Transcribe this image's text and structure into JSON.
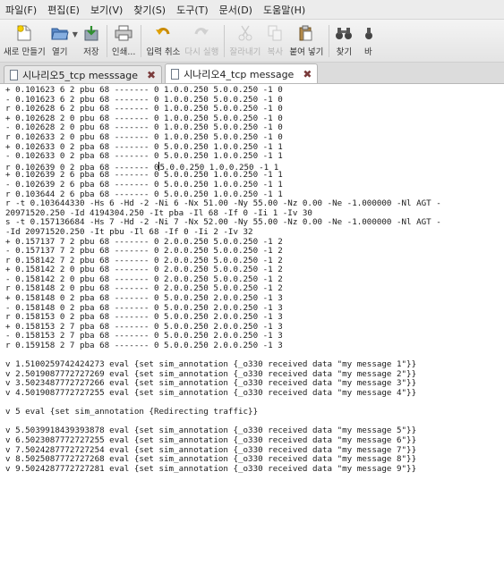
{
  "menu": [
    "파일(F)",
    "편집(E)",
    "보기(V)",
    "찾기(S)",
    "도구(T)",
    "문서(D)",
    "도움말(H)"
  ],
  "toolbar": {
    "new": "새로 만들기",
    "open": "열기",
    "save": "저장",
    "print": "인쇄...",
    "undo": "입력 취소",
    "redo": "다시 실행",
    "cut": "잘라내기",
    "copy": "복사",
    "paste": "붙여 넣기",
    "find": "찾기",
    "replace": "바"
  },
  "tabs": [
    {
      "label": "시나리오5_tcp messsage"
    },
    {
      "label": "시나리오4_tcp message"
    }
  ],
  "log": {
    "block1": [
      "+ 0.101623 6 2 pbu 68 ------- 0 1.0.0.250 5.0.0.250 -1 0",
      "- 0.101623 6 2 pbu 68 ------- 0 1.0.0.250 5.0.0.250 -1 0",
      "r 0.102628 6 2 pbu 68 ------- 0 1.0.0.250 5.0.0.250 -1 0",
      "+ 0.102628 2 0 pbu 68 ------- 0 1.0.0.250 5.0.0.250 -1 0",
      "- 0.102628 2 0 pbu 68 ------- 0 1.0.0.250 5.0.0.250 -1 0",
      "r 0.102633 2 0 pbu 68 ------- 0 1.0.0.250 5.0.0.250 -1 0",
      "+ 0.102633 0 2 pba 68 ------- 0 5.0.0.250 1.0.0.250 -1 1",
      "- 0.102633 0 2 pba 68 ------- 0 5.0.0.250 1.0.0.250 -1 1",
      "r 0.102639 0 2 pba 68 ------- 0",
      "5.0.0.250 1.0.0.250 -1 1",
      "+ 0.102639 2 6 pba 68 ------- 0 5.0.0.250 1.0.0.250 -1 1",
      "- 0.102639 2 6 pba 68 ------- 0 5.0.0.250 1.0.0.250 -1 1",
      "r 0.103644 2 6 pba 68 ------- 0 5.0.0.250 1.0.0.250 -1 1",
      "r -t 0.103644330 -Hs 6 -Hd -2 -Ni 6 -Nx 51.00 -Ny 55.00 -Nz 0.00 -Ne -1.000000 -Nl AGT -",
      "20971520.250 -Id 4194304.250 -It pba -Il 68 -If 0 -Ii 1 -Iv 30",
      "s -t 0.157136684 -Hs 7 -Hd -2 -Ni 7 -Nx 52.00 -Ny 55.00 -Nz 0.00 -Ne -1.000000 -Nl AGT -",
      "-Id 20971520.250 -It pbu -Il 68 -If 0 -Ii 2 -Iv 32",
      "+ 0.157137 7 2 pbu 68 ------- 0 2.0.0.250 5.0.0.250 -1 2",
      "- 0.157137 7 2 pbu 68 ------- 0 2.0.0.250 5.0.0.250 -1 2",
      "r 0.158142 7 2 pbu 68 ------- 0 2.0.0.250 5.0.0.250 -1 2",
      "+ 0.158142 2 0 pbu 68 ------- 0 2.0.0.250 5.0.0.250 -1 2",
      "- 0.158142 2 0 pbu 68 ------- 0 2.0.0.250 5.0.0.250 -1 2",
      "r 0.158148 2 0 pbu 68 ------- 0 2.0.0.250 5.0.0.250 -1 2",
      "+ 0.158148 0 2 pba 68 ------- 0 5.0.0.250 2.0.0.250 -1 3",
      "- 0.158148 0 2 pba 68 ------- 0 5.0.0.250 2.0.0.250 -1 3",
      "r 0.158153 0 2 pba 68 ------- 0 5.0.0.250 2.0.0.250 -1 3",
      "+ 0.158153 2 7 pba 68 ------- 0 5.0.0.250 2.0.0.250 -1 3",
      "- 0.158153 2 7 pba 68 ------- 0 5.0.0.250 2.0.0.250 -1 3",
      "r 0.159158 2 7 pba 68 ------- 0 5.0.0.250 2.0.0.250 -1 3"
    ],
    "block2": [
      "v 1.5100259742424273 eval {set sim_annotation {_o330 received data \"my message 1\"}}",
      "v 2.5019087772727269 eval {set sim_annotation {_o330 received data \"my message 2\"}}",
      "v 3.5023487772727266 eval {set sim_annotation {_o330 received data \"my message 3\"}}",
      "v 4.5019087772727255 eval {set sim_annotation {_o330 received data \"my message 4\"}}"
    ],
    "block3": [
      "v 5 eval {set sim_annotation {Redirecting traffic}}"
    ],
    "block4": [
      "v 5.5039918439393878 eval {set sim_annotation {_o330 received data \"my message 5\"}}",
      "v 6.5023087772727255 eval {set sim_annotation {_o330 received data \"my message 6\"}}",
      "v 7.5024287772727254 eval {set sim_annotation {_o330 received data \"my message 7\"}}",
      "v 8.5025087772727268 eval {set sim_annotation {_o330 received data \"my message 8\"}}",
      "v 9.5024287772727281 eval {set sim_annotation {_o330 received data \"my message 9\"}}"
    ]
  }
}
